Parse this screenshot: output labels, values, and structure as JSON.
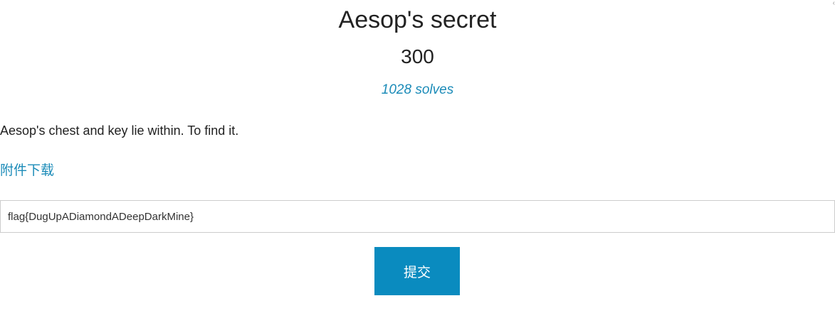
{
  "challenge": {
    "title": "Aesop's secret",
    "points": "300",
    "solves": "1028 solves",
    "description": "Aesop's chest and key lie within. To find it.",
    "download_label": "附件下载"
  },
  "flag_form": {
    "input_value": "flag{DugUpADiamondADeepDarkMine}",
    "submit_label": "提交"
  },
  "window": {
    "close_glyph": "‹"
  },
  "colors": {
    "accent": "#1b8bb8",
    "button": "#0a8bbf",
    "text": "#222222",
    "input_border": "#cccccc"
  }
}
